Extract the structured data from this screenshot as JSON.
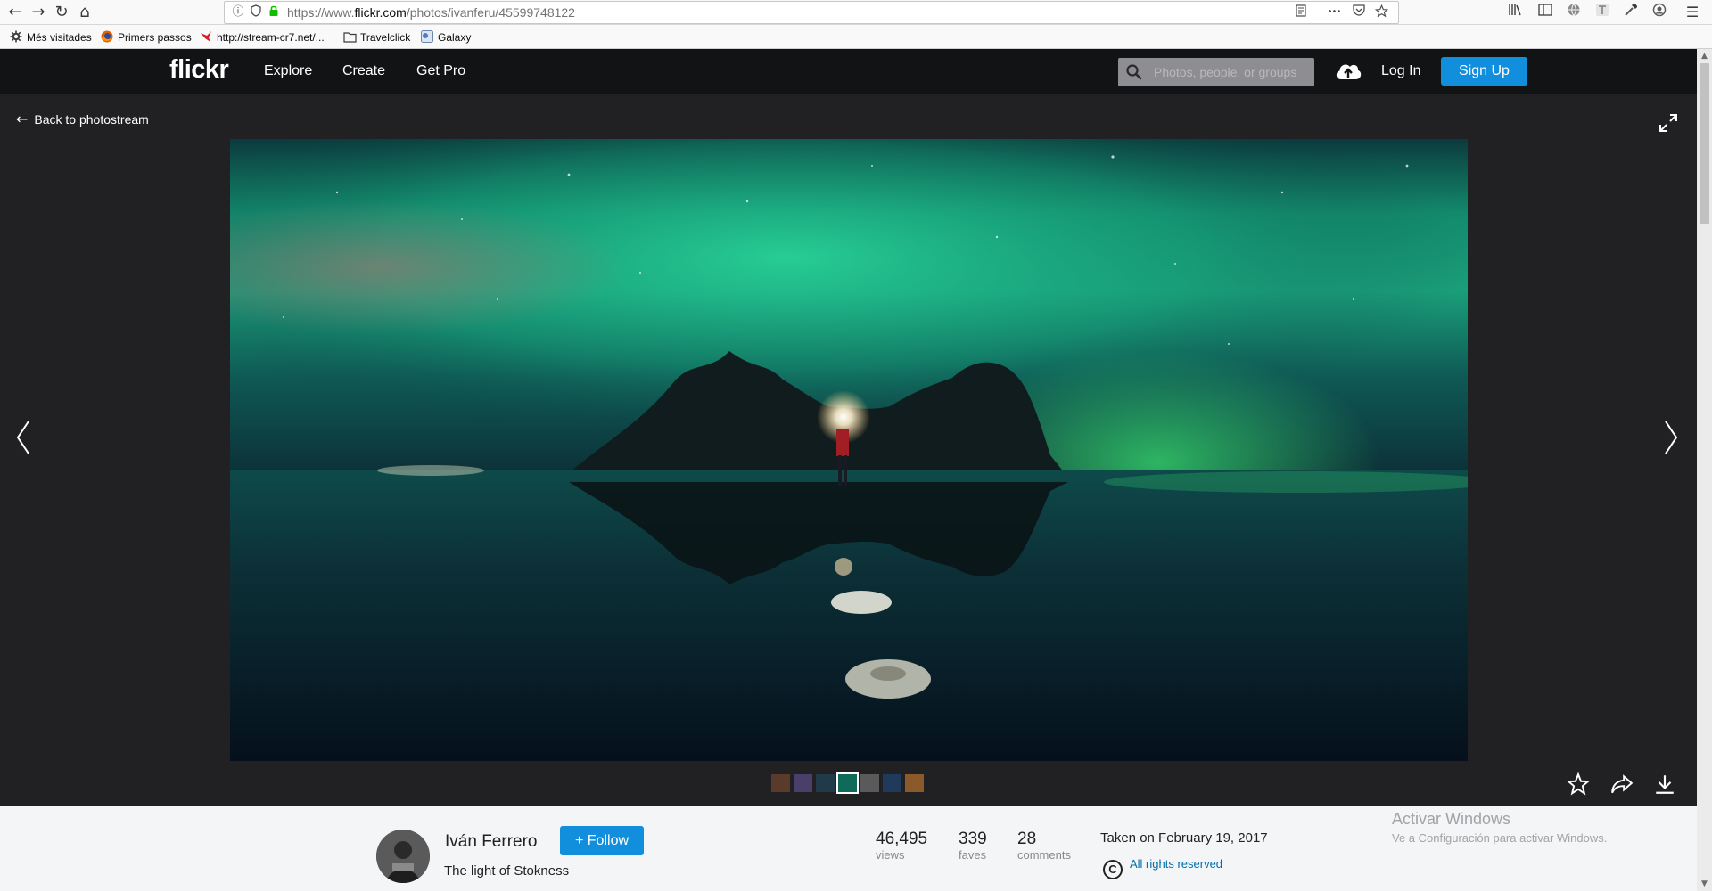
{
  "browser": {
    "url_prefix": "https://www.",
    "url_domain": "flickr.com",
    "url_path": "/photos/ivanferu/45599748122",
    "back_glyph": "←",
    "forward_glyph": "→",
    "reload_glyph": "↻",
    "home_glyph": "⌂",
    "info_glyph": "ⓘ",
    "menu_dots": "•••",
    "menu_glyph": "☰",
    "bookmarks": [
      {
        "label": "Més visitades",
        "icon": "gear-icon"
      },
      {
        "label": "Primers passos",
        "icon": "firefox-icon"
      },
      {
        "label": "http://stream-cr7.net/...",
        "icon": "bird-icon"
      },
      {
        "label": "Travelclick",
        "icon": "folder-icon"
      },
      {
        "label": "Galaxy",
        "icon": "galaxy-icon"
      }
    ]
  },
  "header": {
    "logo": "flickr",
    "nav": [
      "Explore",
      "Create",
      "Get Pro"
    ],
    "search_placeholder": "Photos, people, or groups",
    "login": "Log In",
    "signup": "Sign Up",
    "accent": "#128fdc"
  },
  "stage": {
    "back_arrow": "←",
    "back_label": "Back to photostream",
    "thumb_colors": [
      "#5a3a2a",
      "#4a3f6a",
      "#203a4a",
      "#0f6a5a",
      "#5a5a5a",
      "#1f3a5a",
      "#8a5a2a"
    ]
  },
  "info": {
    "author": "Iván Ferrero",
    "follow_label": "Follow",
    "photo_title": "The light of Stokness",
    "stats": [
      {
        "value": "46,495",
        "label": "views"
      },
      {
        "value": "339",
        "label": "faves"
      },
      {
        "value": "28",
        "label": "comments"
      }
    ],
    "taken": "Taken on February 19, 2017",
    "license_symbol": "C",
    "license": "All rights reserved",
    "activate_title": "Activar Windows",
    "activate_sub": "Ve a Configuración para activar Windows."
  }
}
